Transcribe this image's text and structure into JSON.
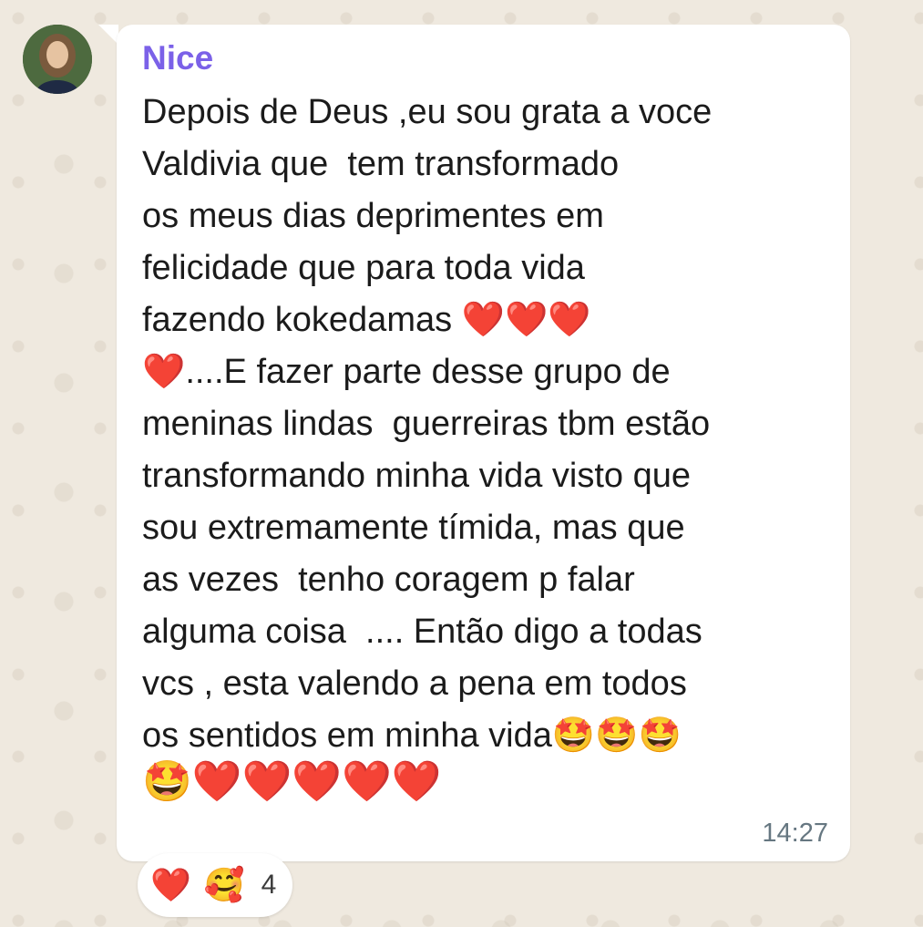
{
  "message": {
    "sender": "Nice",
    "lines": [
      "Depois de Deus ,eu sou grata a voce",
      "Valdivia que  tem transformado",
      "os meus dias deprimentes em",
      "felicidade que para toda vida",
      "fazendo kokedamas ❤️❤️❤️",
      "❤️....E fazer parte desse grupo de",
      "meninas lindas  guerreiras tbm estão",
      "transformando minha vida visto que",
      "sou extremamente tímida, mas que",
      "as vezes  tenho coragem p falar",
      "alguma coisa  .... Então digo a todas",
      "vcs , esta valendo a pena em todos",
      "os sentidos em minha vida🤩🤩🤩",
      "🤩❤️❤️❤️❤️❤️"
    ],
    "time": "14:27"
  },
  "reactions": {
    "emoji_1": "❤️",
    "emoji_2": "🥰",
    "count": "4"
  },
  "colors": {
    "sender_name": "#7b61e8",
    "bubble": "#ffffff",
    "wallpaper": "#efe9df",
    "timestamp": "#667781"
  }
}
